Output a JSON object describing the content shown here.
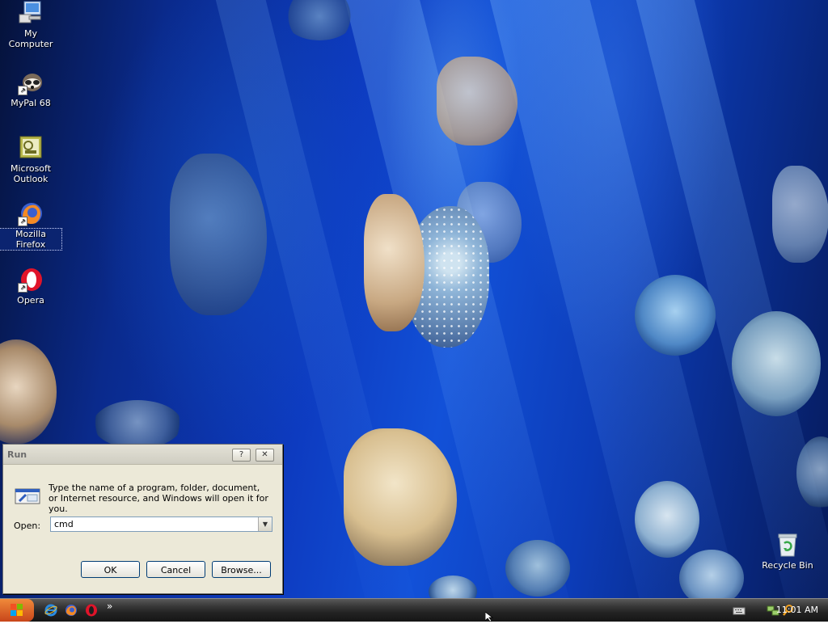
{
  "desktop": {
    "icons": [
      {
        "label": "My Computer",
        "icon": "computer-icon"
      },
      {
        "label": "MyPal 68",
        "icon": "raccoon-icon"
      },
      {
        "label": "Microsoft Outlook",
        "icon": "outlook-icon"
      },
      {
        "label": "Mozilla Firefox",
        "icon": "firefox-icon"
      },
      {
        "label": "Opera",
        "icon": "opera-icon"
      },
      {
        "label": "Recycle Bin",
        "icon": "recycle-bin-icon"
      }
    ]
  },
  "run_dialog": {
    "title": "Run",
    "help_button": "?",
    "close_button": "✕",
    "description": "Type the name of a program, folder, document, or Internet resource, and Windows will open it for you.",
    "open_label": "Open:",
    "open_value": "cmd",
    "ok_label": "OK",
    "cancel_label": "Cancel",
    "browse_label": "Browse..."
  },
  "taskbar": {
    "quick_launch_more": "»",
    "clock": "11:01 AM"
  },
  "colors": {
    "dialog_bg": "#ece9d8",
    "taskbar_bg": "#232323",
    "start_orange": "#e0682a",
    "desktop_blue": "#0d3bc0"
  }
}
